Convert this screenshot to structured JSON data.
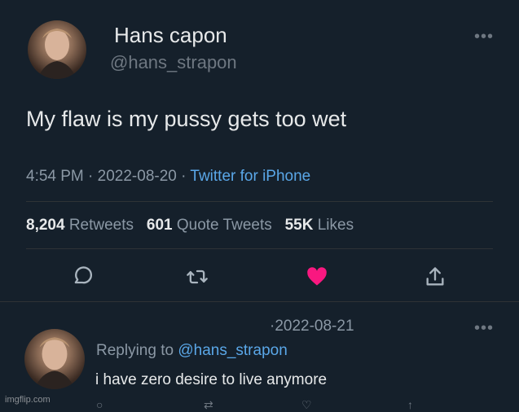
{
  "tweet": {
    "name": "Hans capon",
    "handle": "@hans_strapon",
    "more_icon": "more-dots-icon",
    "text": "My flaw is my pussy gets too wet",
    "time": "4:54 PM",
    "date": "2022-08-20",
    "source": "Twitter for iPhone",
    "retweets_count": "8,204",
    "retweets_label": "Retweets",
    "quotes_count": "601",
    "quotes_label": "Quote Tweets",
    "likes_count": "55K",
    "likes_label": "Likes",
    "actions": [
      "reply-icon",
      "retweet-icon",
      "like-icon",
      "share-icon"
    ],
    "like_color": "#f91880"
  },
  "reply": {
    "date": "2022-08-21",
    "replying_label": "Replying to",
    "replying_handle": "@hans_strapon",
    "text": "i have zero desire to live anymore"
  },
  "watermark": "imgflip.com"
}
